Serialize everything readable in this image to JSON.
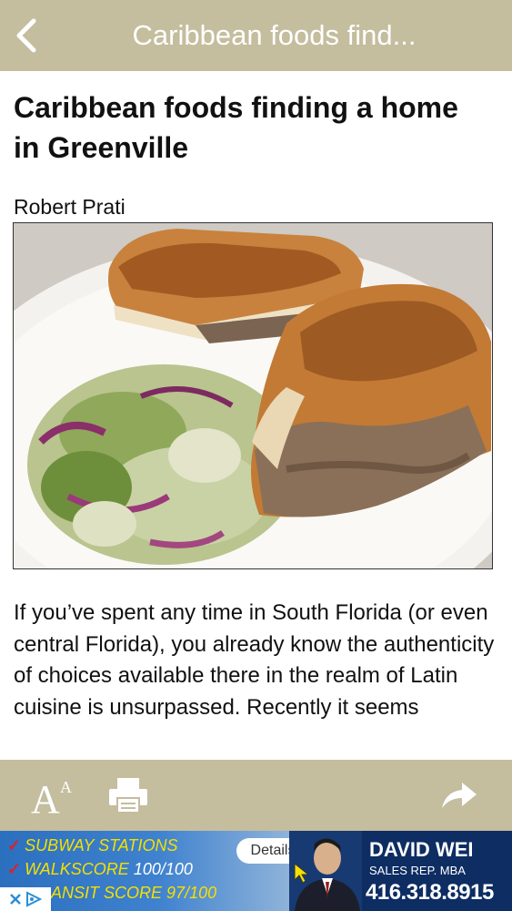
{
  "header": {
    "title": "Caribbean foods find..."
  },
  "article": {
    "headline": "Caribbean foods finding a home in Greenville",
    "byline": "Robert Prati",
    "image_alt": "Pressed Cuban-style sandwich with pulled pork next to a shredded cabbage and Brussels sprout slaw on a white plate",
    "body": "If you’ve spent any time in South Florida (or even central Florida), you already know the authenticity of choices available there in the realm of Latin cuisine is unsurpassed. Recently it seems"
  },
  "toolbar": {
    "text_size_icon": "text-size-icon",
    "print_icon": "printer-icon",
    "share_icon": "share-arrow-icon"
  },
  "ad": {
    "line1": "SUBWAY STATIONS",
    "line2_a": "WALKSCORE",
    "line2_b": "100/100",
    "line3_a": "ANSIT SCORE",
    "line3_b": "97/100",
    "details_label": "Details",
    "name": "DAVID WEI",
    "role": "SALES REP. MBA",
    "phone": "416.318.8915"
  },
  "colors": {
    "bar": "#c4bd9e",
    "ad_navy": "#0d2d63",
    "ad_highlight": "#f5e000"
  }
}
